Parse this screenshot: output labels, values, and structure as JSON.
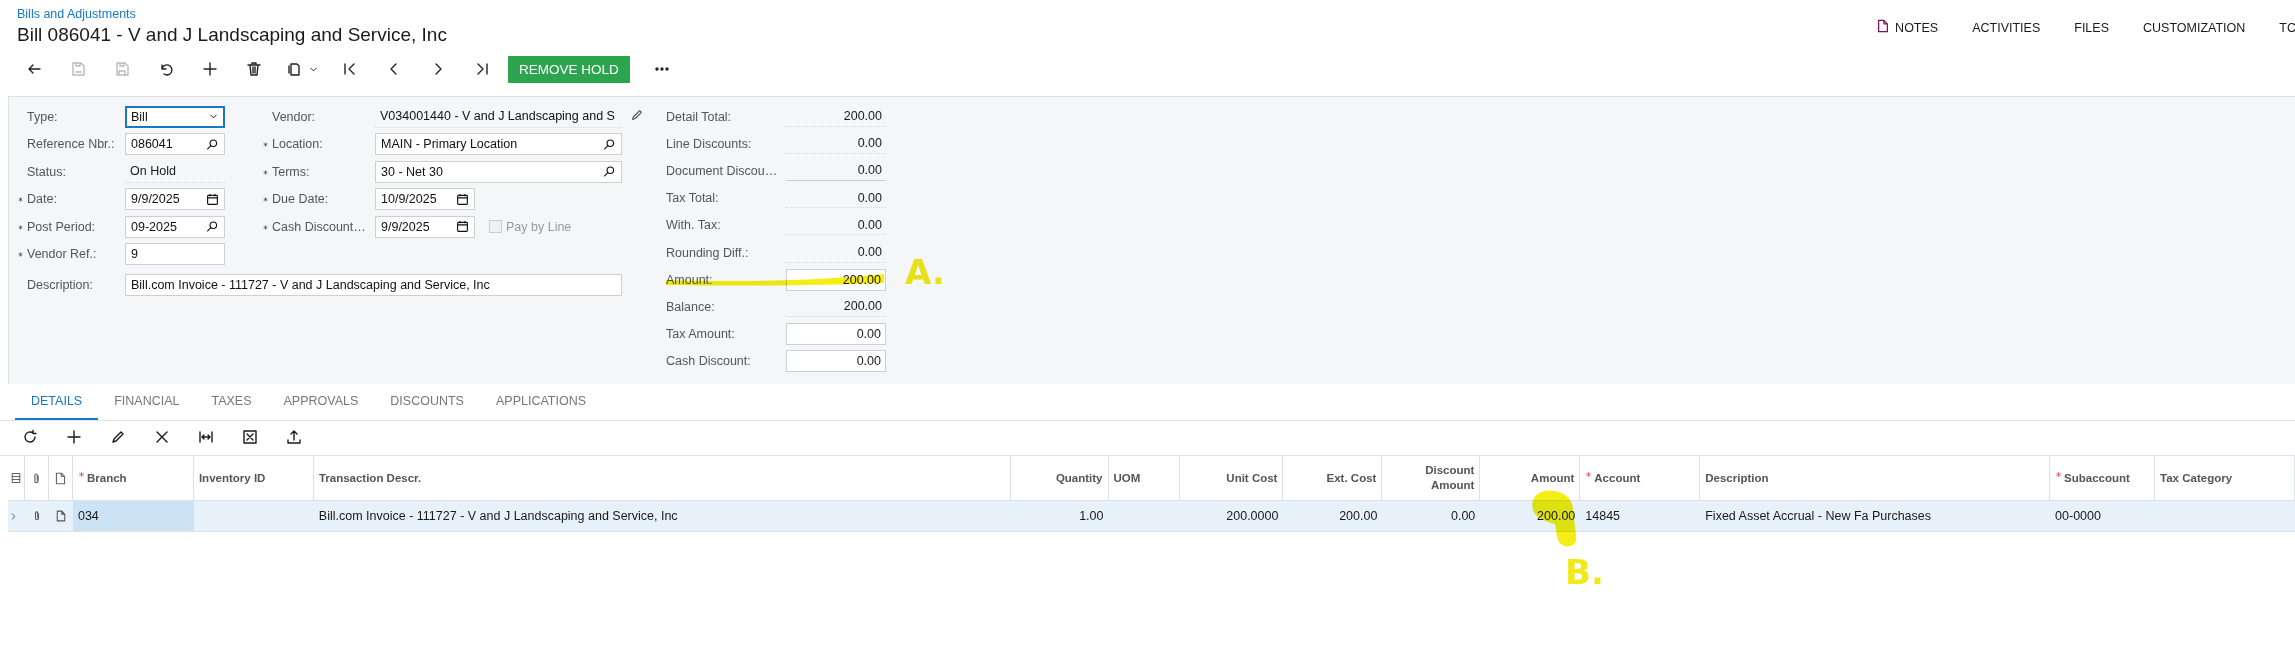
{
  "breadcrumb": "Bills and Adjustments",
  "title": "Bill 086041 - V and J Landscaping and Service, Inc",
  "top_links": [
    {
      "label": "NOTES",
      "kind": "notes"
    },
    {
      "label": "ACTIVITIES",
      "kind": "plain"
    },
    {
      "label": "FILES",
      "kind": "plain"
    },
    {
      "label": "CUSTOMIZATION",
      "kind": "plain"
    },
    {
      "label": "TC",
      "kind": "plain"
    }
  ],
  "toolbar": [
    {
      "kind": "back",
      "disabled": false
    },
    {
      "kind": "save-close",
      "disabled": true
    },
    {
      "kind": "save",
      "disabled": true
    },
    {
      "kind": "undo",
      "disabled": false
    },
    {
      "kind": "add",
      "disabled": false
    },
    {
      "kind": "delete",
      "disabled": false
    },
    {
      "kind": "copy",
      "disabled": false
    },
    {
      "kind": "first",
      "disabled": false
    },
    {
      "kind": "prev",
      "disabled": false
    },
    {
      "kind": "next",
      "disabled": false
    },
    {
      "kind": "last",
      "disabled": false
    },
    {
      "kind": "button",
      "label": "REMOVE HOLD",
      "disabled": false
    },
    {
      "kind": "more",
      "disabled": false
    }
  ],
  "left_fields": [
    {
      "label": "Type:",
      "required": false,
      "kind": "select",
      "value": "Bill",
      "focused": true
    },
    {
      "label": "Reference Nbr.:",
      "required": false,
      "kind": "lookup",
      "value": "086041"
    },
    {
      "label": "Status:",
      "required": false,
      "kind": "readonly",
      "value": "On Hold"
    },
    {
      "label": "Date:",
      "required": true,
      "kind": "date",
      "value": "9/9/2025"
    },
    {
      "label": "Post Period:",
      "required": true,
      "kind": "lookup",
      "value": "09-2025"
    },
    {
      "label": "Vendor Ref.:",
      "required": true,
      "kind": "text",
      "value": "9"
    }
  ],
  "right_fields": [
    {
      "label": "Vendor:",
      "required": false,
      "kind": "edit",
      "value": "V034001440 - V and J Landscaping and S"
    },
    {
      "label": "Location:",
      "required": true,
      "kind": "lookup",
      "value": "MAIN - Primary Location"
    },
    {
      "label": "Terms:",
      "required": true,
      "kind": "lookup",
      "value": "30 - Net 30"
    },
    {
      "label": "Due Date:",
      "required": true,
      "kind": "date",
      "value": "10/9/2025"
    },
    {
      "label": "Cash Discount…",
      "required": true,
      "kind": "date",
      "value": "9/9/2025"
    }
  ],
  "pay_by_line": {
    "label": "Pay by Line",
    "checked": false,
    "disabled": true
  },
  "description": {
    "label": "Description:",
    "value": "Bill.com Invoice - 111727 - V and J Landscaping and Service, Inc"
  },
  "totals": [
    {
      "label": "Detail Total:",
      "value": "200.00",
      "kind": "readonly"
    },
    {
      "label": "Line Discounts:",
      "value": "0.00",
      "kind": "readonly"
    },
    {
      "label": "Document Discou…",
      "value": "0.00",
      "kind": "underlined"
    },
    {
      "label": "Tax Total:",
      "value": "0.00",
      "kind": "readonly"
    },
    {
      "label": "With. Tax:",
      "value": "0.00",
      "kind": "readonly"
    },
    {
      "label": "Rounding Diff.:",
      "value": "0.00",
      "kind": "readonly"
    },
    {
      "label": "Amount:",
      "value": "200.00",
      "kind": "input"
    },
    {
      "label": "Balance:",
      "value": "200.00",
      "kind": "readonly"
    },
    {
      "label": "Tax Amount:",
      "value": "0.00",
      "kind": "input"
    },
    {
      "label": "Cash Discount:",
      "value": "0.00",
      "kind": "input"
    }
  ],
  "tabs": [
    {
      "label": "DETAILS",
      "selected": true
    },
    {
      "label": "FINANCIAL",
      "selected": false
    },
    {
      "label": "TAXES",
      "selected": false
    },
    {
      "label": "APPROVALS",
      "selected": false
    },
    {
      "label": "DISCOUNTS",
      "selected": false
    },
    {
      "label": "APPLICATIONS",
      "selected": false
    }
  ],
  "table": {
    "columns": [
      {
        "label": "Branch",
        "required": true
      },
      {
        "label": "Inventory ID",
        "required": false
      },
      {
        "label": "Transaction Descr.",
        "required": false
      },
      {
        "label": "Quantity",
        "required": false
      },
      {
        "label": "UOM",
        "required": false
      },
      {
        "label": "Unit Cost",
        "required": false
      },
      {
        "label": "Ext. Cost",
        "required": false
      },
      {
        "label": "Discount Amount",
        "required": false
      },
      {
        "label": "Amount",
        "required": false
      },
      {
        "label": "Account",
        "required": true
      },
      {
        "label": "Description",
        "required": false
      },
      {
        "label": "Subaccount",
        "required": true
      },
      {
        "label": "Tax Category",
        "required": false
      }
    ],
    "rows": [
      {
        "selected": true,
        "cells": [
          "034",
          "",
          "Bill.com Invoice - 111727 - V and J Landscaping and Service, Inc",
          "1.00",
          "",
          "200.0000",
          "200.00",
          "0.00",
          "200.00",
          "14845",
          "Fixed Asset Accrual - New Fa Purchases",
          "00-0000",
          ""
        ]
      }
    ]
  },
  "annotations": [
    {
      "label": "A."
    },
    {
      "label": "B."
    }
  ]
}
